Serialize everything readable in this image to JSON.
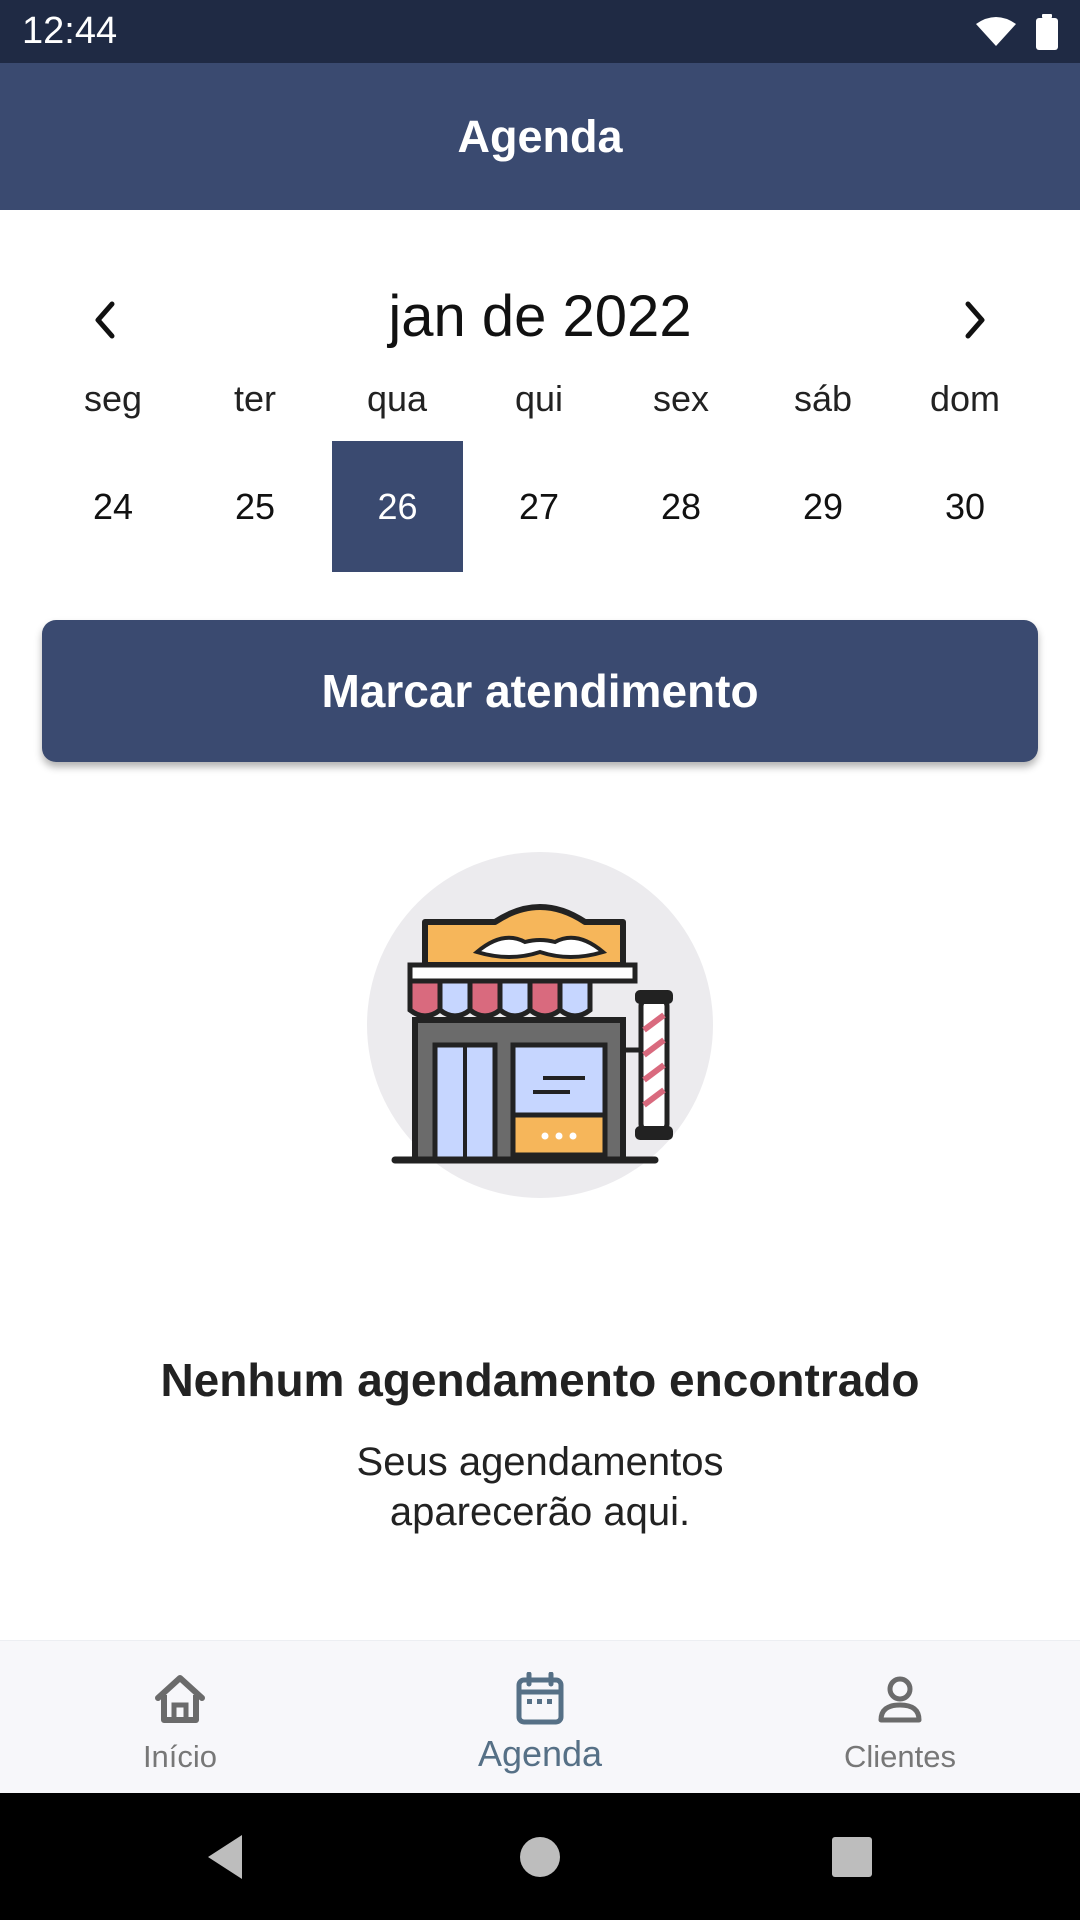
{
  "status_bar": {
    "time": "12:44",
    "icons": [
      "wifi-icon",
      "battery-icon"
    ]
  },
  "app_bar": {
    "title": "Agenda"
  },
  "calendar": {
    "month_label": "jan de 2022",
    "weekdays": [
      "seg",
      "ter",
      "qua",
      "qui",
      "sex",
      "sáb",
      "dom"
    ],
    "days": [
      "24",
      "25",
      "26",
      "27",
      "28",
      "29",
      "30"
    ],
    "selected_day": "26"
  },
  "actions": {
    "book_label": "Marcar atendimento"
  },
  "empty_state": {
    "title": "Nenhum agendamento encontrado",
    "line1": "Seus agendamentos",
    "line2": "aparecerão aqui.",
    "illustration": "barbershop-icon"
  },
  "bottom_nav": {
    "items": [
      {
        "label": "Início",
        "icon": "home-icon"
      },
      {
        "label": "Agenda",
        "icon": "calendar-icon",
        "active": true
      },
      {
        "label": "Clientes",
        "icon": "person-icon"
      }
    ]
  },
  "system_nav": {
    "buttons": [
      "back-icon",
      "home-circle-icon",
      "recents-icon"
    ]
  },
  "colors": {
    "primary": "#3a4a70",
    "status_bar": "#1f2a44",
    "nav_active": "#567086"
  }
}
